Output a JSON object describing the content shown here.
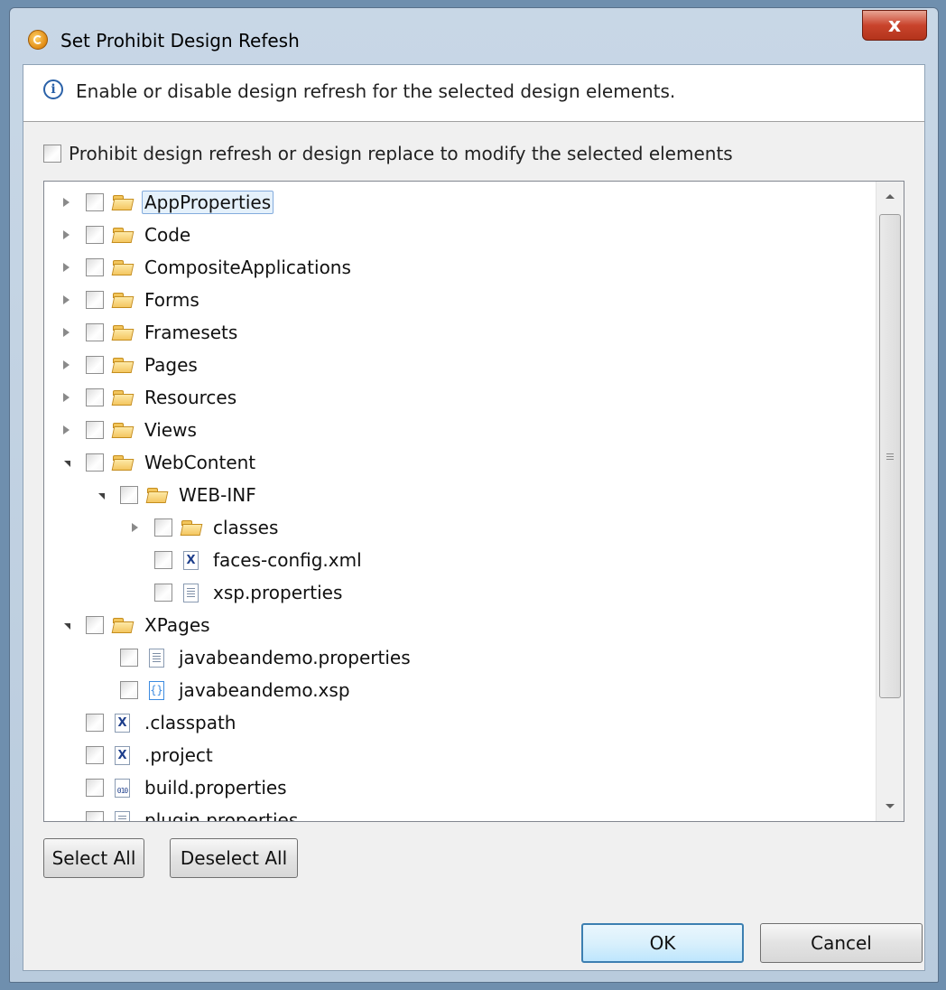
{
  "dialog": {
    "title": "Set Prohibit Design Refesh",
    "close_label": "x"
  },
  "info": {
    "message": "Enable or disable design refresh for the selected design elements."
  },
  "prohibit": {
    "label": "Prohibit design refresh or design replace to modify the selected elements",
    "checked": false
  },
  "tree": {
    "items": [
      {
        "label": "AppProperties",
        "icon": "folder-icon",
        "expander": "collapsed",
        "depth": 0,
        "selected": true
      },
      {
        "label": "Code",
        "icon": "folder-icon",
        "expander": "collapsed",
        "depth": 0
      },
      {
        "label": "CompositeApplications",
        "icon": "folder-icon",
        "expander": "collapsed",
        "depth": 0
      },
      {
        "label": "Forms",
        "icon": "folder-icon",
        "expander": "collapsed",
        "depth": 0
      },
      {
        "label": "Framesets",
        "icon": "folder-icon",
        "expander": "collapsed",
        "depth": 0
      },
      {
        "label": "Pages",
        "icon": "folder-icon",
        "expander": "collapsed",
        "depth": 0
      },
      {
        "label": "Resources",
        "icon": "folder-icon",
        "expander": "collapsed",
        "depth": 0
      },
      {
        "label": "Views",
        "icon": "folder-icon",
        "expander": "collapsed",
        "depth": 0
      },
      {
        "label": "WebContent",
        "icon": "folder-icon",
        "expander": "expanded",
        "depth": 0
      },
      {
        "label": "WEB-INF",
        "icon": "folder-icon",
        "expander": "expanded",
        "depth": 1
      },
      {
        "label": "classes",
        "icon": "folder-icon",
        "expander": "collapsed",
        "depth": 2
      },
      {
        "label": "faces-config.xml",
        "icon": "xml-file-icon",
        "expander": "none",
        "depth": 2
      },
      {
        "label": "xsp.properties",
        "icon": "text-file-icon",
        "expander": "none",
        "depth": 2
      },
      {
        "label": "XPages",
        "icon": "folder-icon",
        "expander": "expanded",
        "depth": 0
      },
      {
        "label": "javabeandemo.properties",
        "icon": "text-file-icon",
        "expander": "none",
        "depth": 1
      },
      {
        "label": "javabeandemo.xsp",
        "icon": "xsp-file-icon",
        "expander": "none",
        "depth": 1
      },
      {
        "label": ".classpath",
        "icon": "xml-file-icon",
        "expander": "none",
        "depth": 0
      },
      {
        "label": ".project",
        "icon": "xml-file-icon",
        "expander": "none",
        "depth": 0
      },
      {
        "label": "build.properties",
        "icon": "binary-file-icon",
        "expander": "none",
        "depth": 0
      },
      {
        "label": "plugin.properties",
        "icon": "text-file-icon",
        "expander": "none",
        "depth": 0
      }
    ]
  },
  "icon_glyphs": {
    "xml": "X",
    "xsp": "{}",
    "binary": "010"
  },
  "buttons": {
    "select_all": "Select All",
    "deselect_all": "Deselect All",
    "ok": "OK",
    "cancel": "Cancel"
  }
}
